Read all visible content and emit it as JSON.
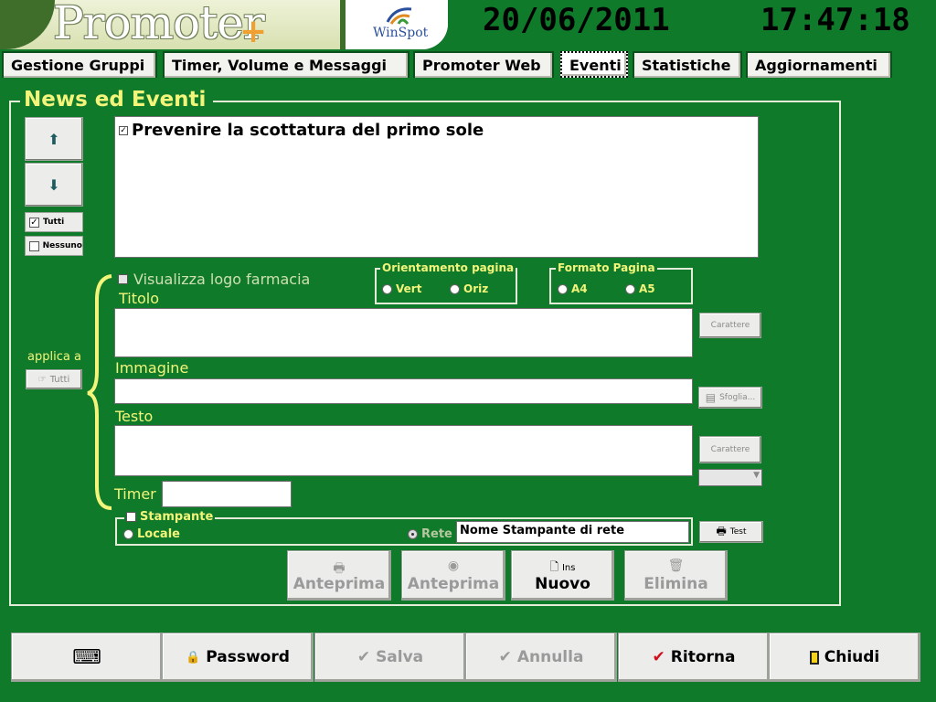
{
  "header": {
    "logo_text": "Promoter",
    "logo_plus": "+",
    "brand": "WinSpot",
    "date": "20/06/2011",
    "time": "17:47:18"
  },
  "tabs": [
    {
      "label": "Gestione Gruppi"
    },
    {
      "label": "Timer, Volume e Messaggi"
    },
    {
      "label": "Promoter Web"
    },
    {
      "label": "Eventi"
    },
    {
      "label": "Statistiche"
    },
    {
      "label": "Aggiornamenti"
    }
  ],
  "main": {
    "title": "News ed Eventi",
    "arrow_up": "⬆",
    "arrow_down": "⬇",
    "tutti_label": "Tutti",
    "nessuno_label": "Nessuno",
    "news_items": [
      {
        "title": "Prevenire la scottatura del primo sole",
        "checked": true
      }
    ],
    "visualizza_logo": "Visualizza logo farmacia",
    "orientamento": {
      "legend": "Orientamento pagina",
      "options": [
        "Vert",
        "Oriz"
      ]
    },
    "formato": {
      "legend": "Formato Pagina",
      "options": [
        "A4",
        "A5"
      ]
    },
    "titolo_label": "Titolo",
    "immagine_label": "Immagine",
    "testo_label": "Testo",
    "timer_label": "Timer",
    "applica_a": "applica a",
    "applica_tutti": "Tutti",
    "carattere_label": "Carattere",
    "sfoglia_label": "Sfoglia...",
    "stampante": {
      "legend": "Stampante",
      "locale": "Locale",
      "rete": "Rete",
      "printer_name": "Nome Stampante di rete",
      "test_label": "Test"
    },
    "actions": {
      "anteprima_1": "Anteprima",
      "anteprima_2": "Anteprima",
      "nuovo": "Nuovo",
      "nuovo_icon_text": "Ins",
      "elimina": "Elimina"
    }
  },
  "bottom": {
    "password": "Password",
    "salva": "Salva",
    "annulla": "Annulla",
    "ritorna": "Ritorna",
    "chiudi": "Chiudi"
  },
  "colors": {
    "background": "#0f7a2a",
    "label_yellow": "#f3f57a",
    "ritorna_check": "#d0101a"
  }
}
